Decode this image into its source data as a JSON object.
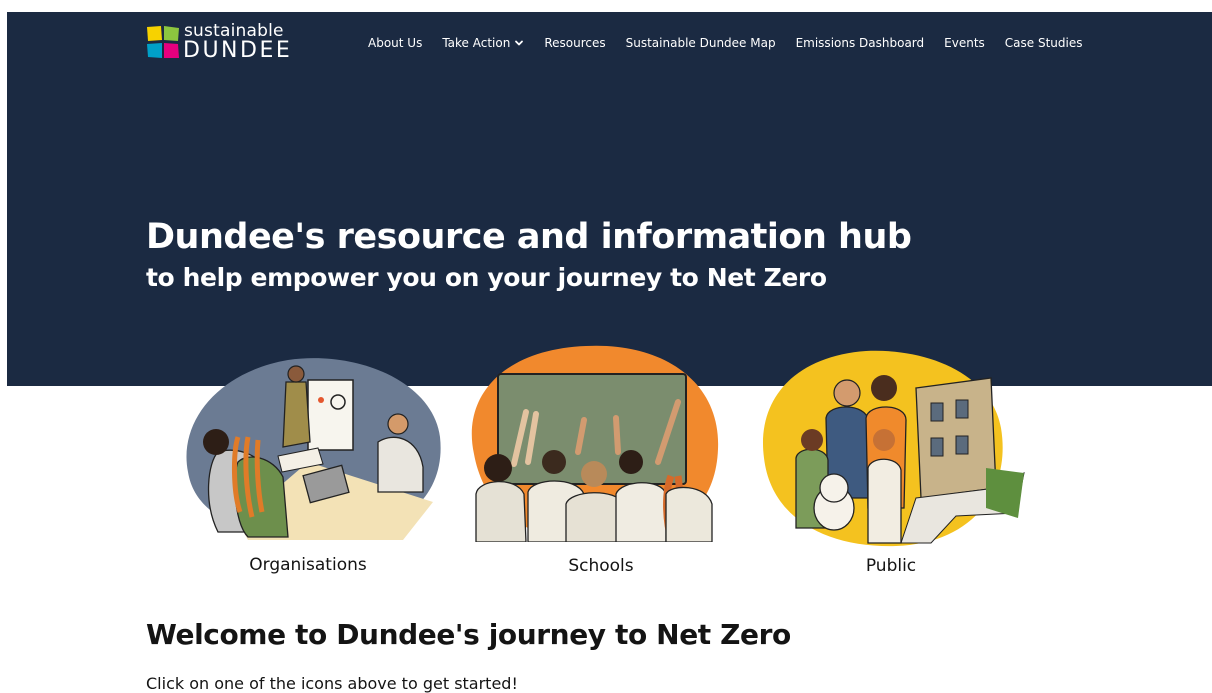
{
  "brand": {
    "name_top": "sustainable",
    "name_bottom": "DUNDEE",
    "colors": {
      "yellow": "#f7d200",
      "green": "#8cc63f",
      "magenta": "#e6007e",
      "blue": "#00a0c8"
    }
  },
  "colors": {
    "hero_background": "#1b2a42",
    "illustration_blue": "#6b7b93",
    "illustration_orange": "#f1892d",
    "illustration_yellow": "#f4c21f"
  },
  "nav": {
    "items": [
      {
        "label": "About Us"
      },
      {
        "label": "Take Action",
        "has_dropdown": true,
        "icon": "chevron-down-icon"
      },
      {
        "label": "Resources"
      },
      {
        "label": "Sustainable Dundee Map"
      },
      {
        "label": "Emissions Dashboard"
      },
      {
        "label": "Events"
      },
      {
        "label": "Case Studies"
      }
    ]
  },
  "hero": {
    "title": "Dundee's resource and information hub",
    "subtitle": "to help empower you on your journey to Net Zero"
  },
  "audiences": [
    {
      "label": "Organisations",
      "icon": "organisations-illustration"
    },
    {
      "label": "Schools",
      "icon": "schools-illustration"
    },
    {
      "label": "Public",
      "icon": "public-illustration"
    }
  ],
  "welcome": {
    "heading": "Welcome to Dundee's journey to Net Zero",
    "intro": "Click on one of the icons above to get started!"
  }
}
